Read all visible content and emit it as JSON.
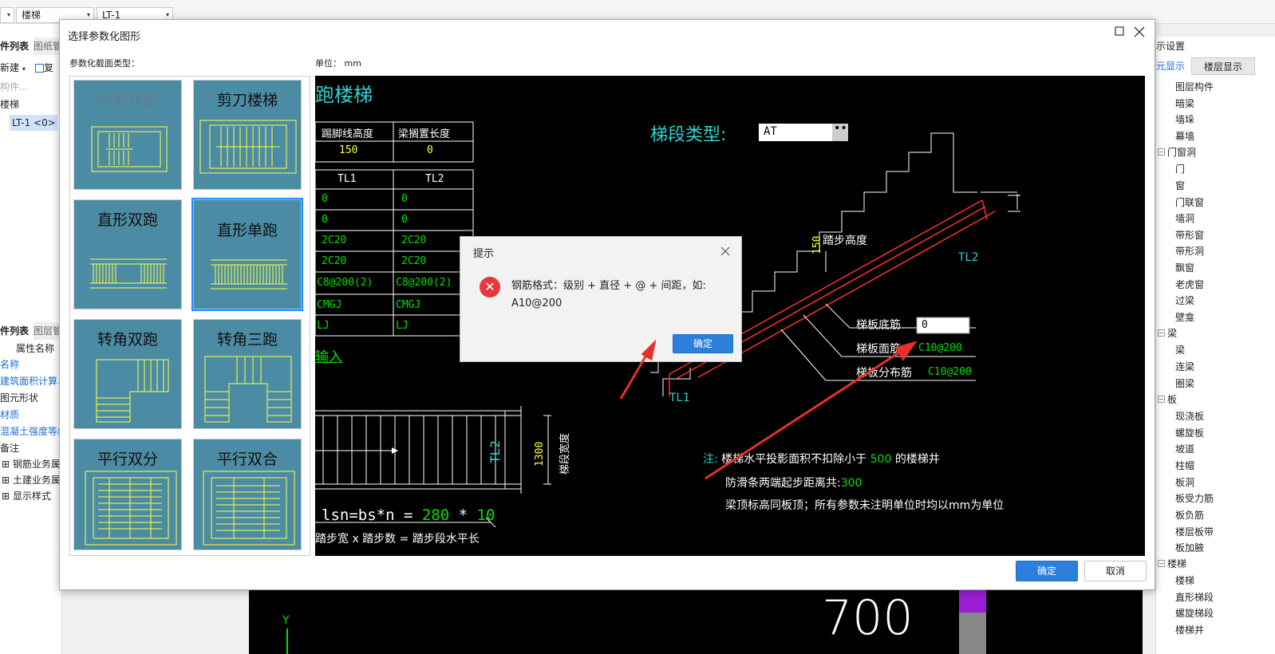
{
  "topbar": {
    "combo1": "楼梯",
    "combo2": "LT-1"
  },
  "left": {
    "tab1": "件列表",
    "tab2": "图纸管",
    "new_label": "新建",
    "copy_label": "复",
    "search_placeholder": "构件...",
    "tree_root": "楼梯",
    "tree_item": "LT-1 <0>",
    "prop_tab1": "件列表",
    "prop_tab2": "图层管",
    "prop_header": "属性名称",
    "props": [
      "名称",
      "建筑面积计算...",
      "图元形状",
      "材质",
      "混凝土强度等级",
      "备注",
      "钢筋业务属",
      "土建业务属",
      "显示样式"
    ]
  },
  "right": {
    "title": "示设置",
    "tab1": "元显示",
    "tab2": "楼层显示",
    "items": [
      "图层构件",
      "暗梁",
      "墙垛",
      "幕墙",
      "门窗洞",
      "门",
      "窗",
      "门联窗",
      "墙洞",
      "带形窗",
      "带形洞",
      "飘窗",
      "老虎窗",
      "过梁",
      "壁龛",
      "梁",
      "梁",
      "连梁",
      "圈梁",
      "板",
      "现浇板",
      "螺旋板",
      "坡道",
      "柱帽",
      "板洞",
      "板受力筋",
      "板负筋",
      "楼层板带",
      "板加腋",
      "楼梯",
      "楼梯",
      "直形梯段",
      "螺旋梯段",
      "楼梯井"
    ]
  },
  "dialog": {
    "title": "选择参数化图形",
    "section_label": "参数化截面类型：",
    "unit_label": "单位： mm",
    "ok": "确定",
    "cancel": "取消",
    "shapes": [
      "标准双跑",
      "剪刀楼梯",
      "直形双跑",
      "直形单跑",
      "转角双跑",
      "转角三跑",
      "平行双分",
      "平行双合"
    ]
  },
  "cad": {
    "title": "跑楼梯",
    "col_h1": "踢脚线高度",
    "col_h2": "梁搁置长度",
    "val_h1": "150",
    "val_h2": "0",
    "tl1": "TL1",
    "tl2": "TL2",
    "rows": [
      [
        "0",
        "0"
      ],
      [
        "0",
        "0"
      ],
      [
        "2C20",
        "2C20"
      ],
      [
        "2C20",
        "2C20"
      ],
      [
        "C8@200(2)",
        "C8@200(2)"
      ],
      [
        "CMGJ",
        "CMGJ"
      ],
      [
        "LJ",
        "LJ"
      ]
    ],
    "input_link": "输入",
    "segment_label": "梯段类型:",
    "segment_value": "AT",
    "step_height_label": "踏步高度",
    "step_height_val": "150",
    "tl2_label": "TL2",
    "tl1_label": "TL1",
    "bottom_bar_label": "梯板底筋",
    "bottom_bar_val": "0",
    "top_bar_label": "梯板面筋",
    "top_bar_val": "C10@200",
    "dist_bar_label": "梯板分布筋",
    "dist_bar_val": "C10@200",
    "plan_tl2": "TL2",
    "plan_width": "1300",
    "plan_width_label": "梯段宽度",
    "formula_a": "lsn=bs*n = ",
    "formula_b": "280",
    "formula_c": " * ",
    "formula_d": "10",
    "formula_caption": "踏步宽 x 踏步数 = 踏步段水平长",
    "note_prefix": "注:",
    "note1a": "楼梯水平投影面积不扣除小于",
    "note1b": "500",
    "note1c": "的楼梯井",
    "note2a": "防滑条两端起步距离共:",
    "note2b": "300",
    "note3": "梁顶标高同板顶；所有参数未注明单位时均以mm为单位"
  },
  "hint": {
    "title": "提示",
    "msg_line1": "钢筋格式：级别 + 直径 + @ + 间距，如:",
    "msg_line2": "A10@200",
    "ok": "确定"
  },
  "bgcad": {
    "number": "700",
    "axis": "Y"
  }
}
